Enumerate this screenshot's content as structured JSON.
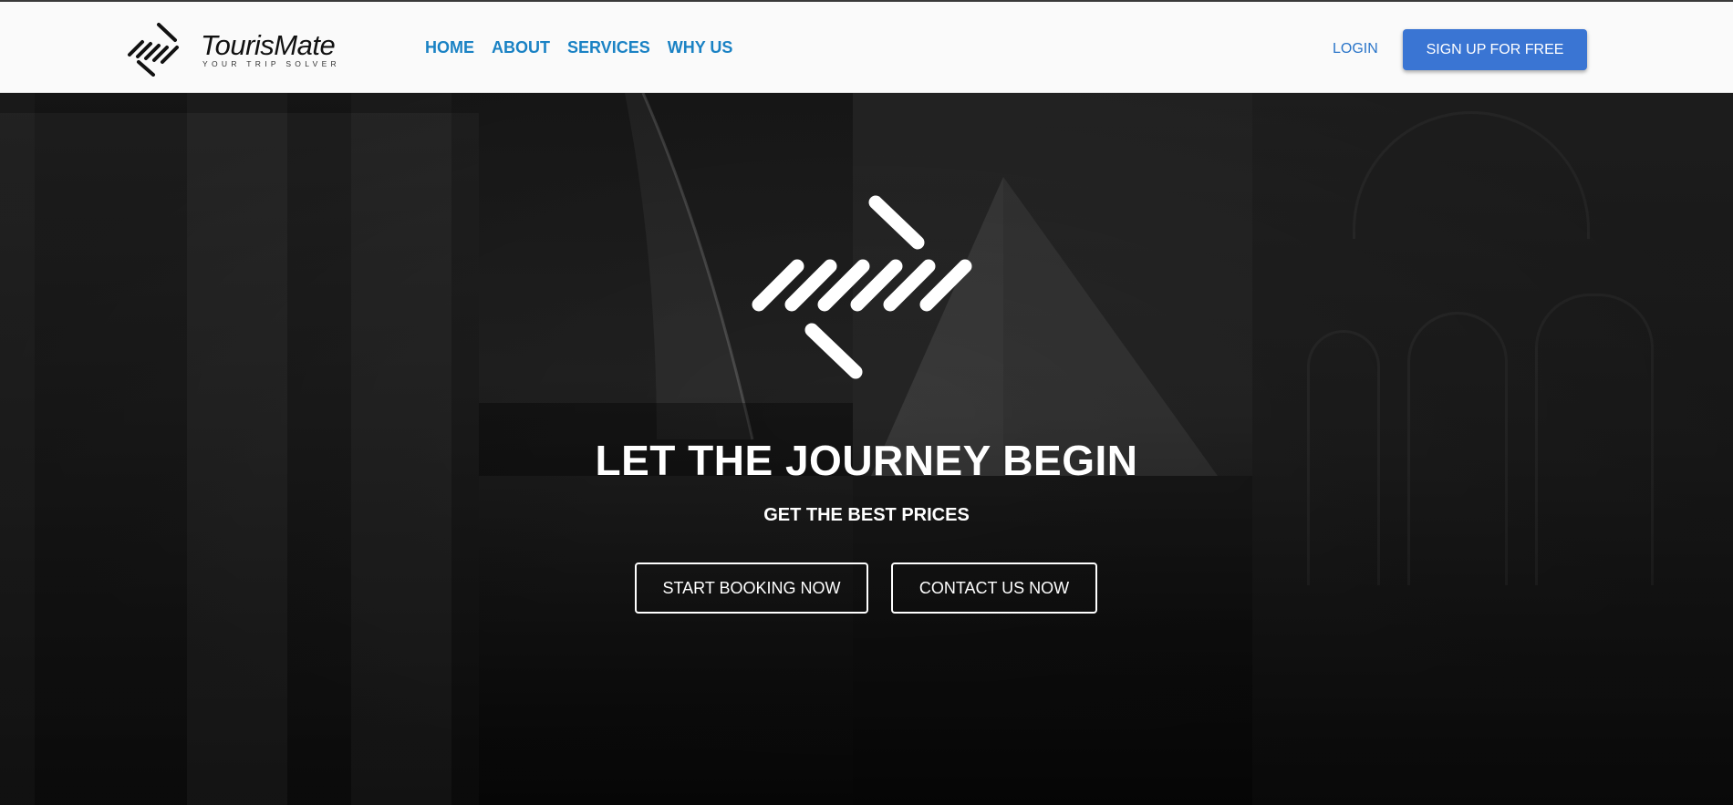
{
  "brand": {
    "name": "TourisMate",
    "tagline": "YOUR TRIP SOLVER"
  },
  "nav": {
    "links": [
      {
        "label": "HOME"
      },
      {
        "label": "ABOUT"
      },
      {
        "label": "SERVICES"
      },
      {
        "label": "WHY US"
      }
    ],
    "login_label": "LOGIN",
    "signup_label": "SIGN UP FOR FREE"
  },
  "hero": {
    "title": "LET THE JOURNEY BEGIN",
    "subtitle": "GET THE BEST PRICES",
    "primary_button": "START BOOKING NOW",
    "secondary_button": "CONTACT US NOW"
  },
  "colors": {
    "nav_link": "#1a82c4",
    "login": "#2a75c9",
    "signup_bg": "#3a75d3",
    "hero_text": "#ffffff"
  },
  "icons": {
    "brand_mark": "arrow-stripes-logo-icon",
    "hero_mark": "arrow-stripes-logo-icon"
  }
}
